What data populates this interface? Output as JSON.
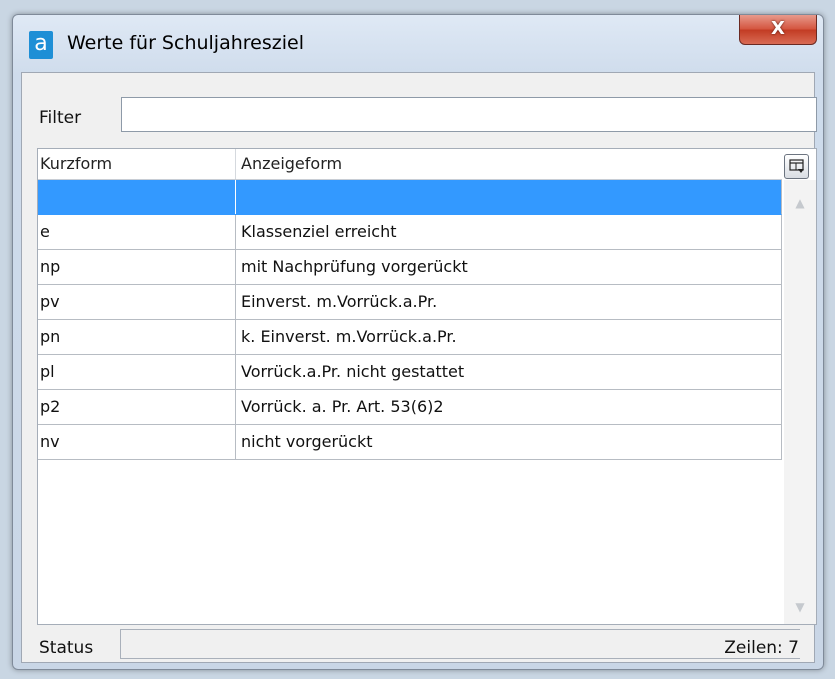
{
  "window": {
    "title": "Werte für Schuljahresziel",
    "app_icon": "a",
    "close_label": "X"
  },
  "filter": {
    "label": "Filter",
    "value": ""
  },
  "grid": {
    "columns": [
      "Kurzform",
      "Anzeigeform"
    ],
    "rows": [
      {
        "kurzform": "",
        "anzeigeform": "",
        "selected": true
      },
      {
        "kurzform": "e",
        "anzeigeform": "Klassenziel erreicht"
      },
      {
        "kurzform": "np",
        "anzeigeform": "mit Nachprüfung vorgerückt"
      },
      {
        "kurzform": "pv",
        "anzeigeform": "Einverst. m.Vorrück.a.Pr."
      },
      {
        "kurzform": "pn",
        "anzeigeform": "k. Einverst. m.Vorrück.a.Pr."
      },
      {
        "kurzform": "pl",
        "anzeigeform": "Vorrück.a.Pr. nicht gestattet"
      },
      {
        "kurzform": "p2",
        "anzeigeform": "Vorrück. a. Pr. Art. 53(6)2"
      },
      {
        "kurzform": "nv",
        "anzeigeform": "nicht vorgerückt"
      }
    ],
    "column_chooser_icon": "column-chooser-icon"
  },
  "status": {
    "label": "Status",
    "row_count": "Zeilen: 7"
  },
  "colors": {
    "selection": "#3399ff",
    "close_button": "#c23b23",
    "app_icon": "#1e8fd6"
  }
}
